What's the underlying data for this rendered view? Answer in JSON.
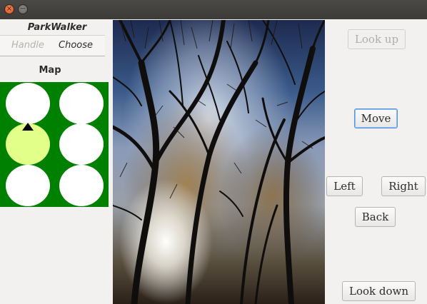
{
  "window": {
    "close_icon_glyph": "×",
    "minimize_icon_glyph": "−"
  },
  "app": {
    "title": "ParkWalker"
  },
  "tabs": [
    {
      "label": "Handle",
      "enabled": false
    },
    {
      "label": "Choose",
      "enabled": true
    }
  ],
  "map": {
    "label": "Map",
    "background_color": "#008000",
    "cell_color": "#ffffff",
    "active_cell_color": "#e2ff8a",
    "active_cell": {
      "row": 1,
      "col": 0
    },
    "marker": "arrow-up",
    "rows": 3,
    "cols": 2
  },
  "buttons": {
    "look_up": "Look up",
    "move": "Move",
    "left": "Left",
    "right": "Right",
    "back": "Back",
    "look_down": "Look down"
  },
  "photo": {
    "subject": "forest canopy with bare trees against a blue sky"
  }
}
